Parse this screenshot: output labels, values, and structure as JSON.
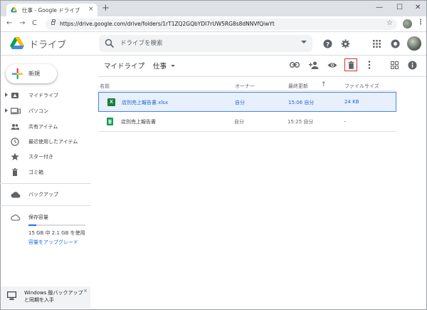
{
  "browser": {
    "tab_title": "仕事 - Google ドライブ",
    "tab_close": "×",
    "new_tab": "+",
    "win_minimize": "—",
    "win_maximize": "☐",
    "win_close": "✕",
    "back": "←",
    "forward": "→",
    "reload": "C",
    "url": "https://drive.google.com/drive/folders/1rT1ZQ2GQbYDI7rUW5RG8s8dNNVfQiwYt",
    "bookmark": "☆",
    "menu": "⋮"
  },
  "header": {
    "app_name": "ドライブ",
    "search_placeholder": "ドライブを検索"
  },
  "sidebar": {
    "new_button": "新規",
    "items": [
      {
        "label": "マイドライブ",
        "icon": "my-drive-icon",
        "expandable": true
      },
      {
        "label": "パソコン",
        "icon": "computers-icon",
        "expandable": true
      },
      {
        "label": "共有アイテム",
        "icon": "shared-icon",
        "expandable": false
      },
      {
        "label": "最近使用したアイテム",
        "icon": "recent-icon",
        "expandable": false
      },
      {
        "label": "スター付き",
        "icon": "star-icon",
        "expandable": false
      },
      {
        "label": "ゴミ箱",
        "icon": "trash-icon",
        "expandable": false
      }
    ],
    "backups": "バックアップ",
    "storage": {
      "label": "保存容量",
      "usage": "15 GB 中 2.1 GB を使用",
      "used_fraction": 0.14,
      "upgrade": "容量をアップグレード"
    },
    "backup_promo": "Windows 版バックアップと同期を入手",
    "backup_close": "×"
  },
  "main": {
    "breadcrumb_root": "マイドライブ",
    "breadcrumb_sep": "›",
    "breadcrumb_current": "仕事",
    "columns": {
      "name": "名前",
      "owner": "オーナー",
      "modified": "最終更新",
      "size": "ファイルサイズ"
    },
    "sort_arrow": "↑",
    "files": [
      {
        "name": "店別売上報告書.xlsx",
        "icon_letter": "X",
        "owner": "自分",
        "modified": "15:06 自分",
        "size": "24 KB",
        "selected": true
      },
      {
        "name": "店別売上報告書",
        "icon_letter": "",
        "owner": "自分",
        "modified": "15:25 自分",
        "size": "–",
        "selected": false
      }
    ]
  },
  "colors": {
    "accent": "#1a73e8",
    "selected_bg": "#e8f0fe",
    "highlight_box": "#d93025",
    "excel_green": "#188038",
    "sheets_green": "#0f9d58"
  }
}
